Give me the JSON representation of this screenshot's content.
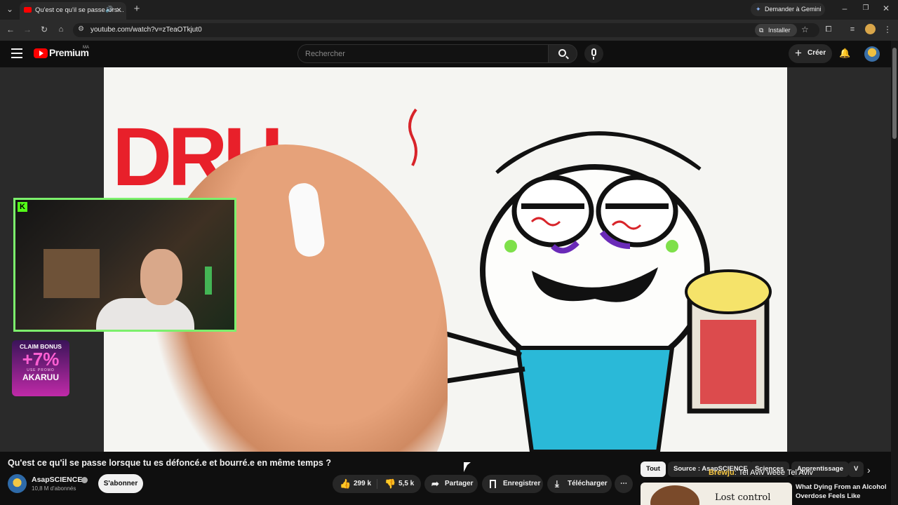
{
  "browser": {
    "tab_title": "Qu'est ce qu'il se passe lors…",
    "url": "youtube.com/watch?v=zTeaOTkjut0",
    "gemini_label": "Demander à Gemini",
    "install_label": "Installer"
  },
  "youtube": {
    "logo_text": "Premium",
    "logo_badge": "MA",
    "search_placeholder": "Rechercher",
    "create_label": "Créer"
  },
  "overlay": {
    "bonus_line1": "CLAIM BONUS",
    "bonus_line2": "+7%",
    "bonus_line3": "USE PROMO",
    "bonus_line4": "AKARUU",
    "video_word": "DRU",
    "chat_user": "Brewju",
    "chat_text": ": Tel Aviv weee Tel Aviv"
  },
  "video": {
    "title": "Qu'est ce qu'il se passe lorsque tu es défoncé.e et bourré.e en même temps ?",
    "channel": "AsapSCIENCE",
    "subscribers": "10,8 M d'abonnés",
    "subscribe_label": "S'abonner",
    "likes": "299 k",
    "dislikes": "5,5 k",
    "share_label": "Partager",
    "save_label": "Enregistrer",
    "download_label": "Télécharger"
  },
  "chips": [
    "Tout",
    "Source : AsapSCIENCE",
    "Sciences",
    "Apprentissage",
    "V"
  ],
  "recommendation": {
    "title": "What Dying From an Alcohol Overdose Feels Like",
    "thumb_text": "Lost control"
  },
  "colors": {
    "youtube_red": "#ff0000",
    "bonus_pink": "#e63cc5",
    "webcam_border": "#7cf06c"
  }
}
